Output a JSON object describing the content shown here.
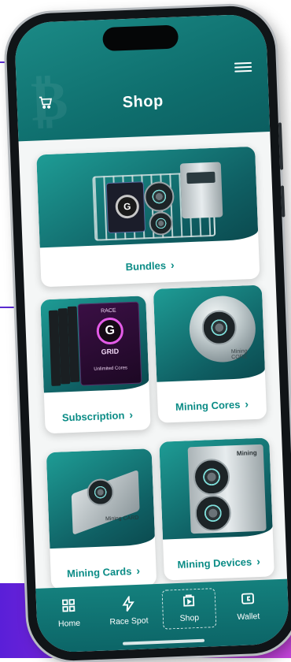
{
  "header": {
    "title": "Shop",
    "cart_icon": "cart-icon",
    "menu_icon": "menu-icon"
  },
  "art_text": {
    "grid_brand": "RACE",
    "grid_letter": "G",
    "grid_name": "GRID",
    "grid_sub": "Unlimited Cores",
    "core_label": "Mining CORE",
    "card_label": "Mining CARD",
    "device_label": "Mining"
  },
  "cards": {
    "bundles": {
      "label": "Bundles"
    },
    "subscription": {
      "label": "Subscription"
    },
    "mining_cores": {
      "label": "Mining Cores"
    },
    "mining_cards": {
      "label": "Mining Cards"
    },
    "mining_devices": {
      "label": "Mining Devices"
    }
  },
  "nav": {
    "items": [
      {
        "label": "Home",
        "icon": "grid-icon"
      },
      {
        "label": "Race Spot",
        "icon": "bolt-icon"
      },
      {
        "label": "Shop",
        "icon": "shop-icon",
        "active": true
      },
      {
        "label": "Wallet",
        "icon": "wallet-icon"
      }
    ]
  },
  "colors": {
    "teal_primary": "#0f6f6e",
    "teal_label": "#0b8c86",
    "accent_purple": "#5a1fd8",
    "accent_magenta": "#c243d8"
  }
}
